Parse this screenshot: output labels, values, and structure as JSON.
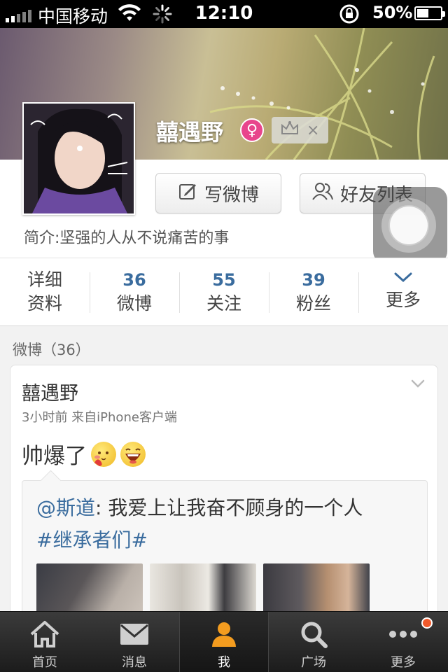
{
  "status_bar": {
    "carrier": "中国移动",
    "time": "12:10",
    "battery": "50%",
    "battery_level": 0.5
  },
  "profile": {
    "username": "囍遇野",
    "gender_symbol": "♀",
    "vip_close": "×",
    "write_button": "写微博",
    "friends_button": "好友列表",
    "bio": "简介:坚强的人从不说痛苦的事"
  },
  "stats": {
    "detail_line1": "详细",
    "detail_line2": "资料",
    "weibo_count": "36",
    "weibo_label": "微博",
    "following_count": "55",
    "following_label": "关注",
    "fans_count": "39",
    "fans_label": "粉丝",
    "more_label": "更多"
  },
  "feed": {
    "section_title": "微博（36）",
    "post": {
      "author": "囍遇野",
      "meta": "3小时前  来自iPhone客户端",
      "text": "帅爆了",
      "repost": {
        "mention": "@斯道",
        "body": ": 我爱上让我奋不顾身的一个人",
        "hashtag": "#继承者们#"
      }
    }
  },
  "tabbar": {
    "tabs": [
      {
        "label": "首页",
        "icon": "home-icon"
      },
      {
        "label": "消息",
        "icon": "envelope-icon"
      },
      {
        "label": "我",
        "icon": "person-icon"
      },
      {
        "label": "广场",
        "icon": "search-icon"
      },
      {
        "label": "更多",
        "icon": "more-dots-icon"
      }
    ],
    "active_index": 2
  },
  "colors": {
    "accent_blue": "#3a6c9e",
    "active_orange": "#f39c1f",
    "gender_pink": "#e8458c",
    "badge_red": "#f25a2b"
  }
}
